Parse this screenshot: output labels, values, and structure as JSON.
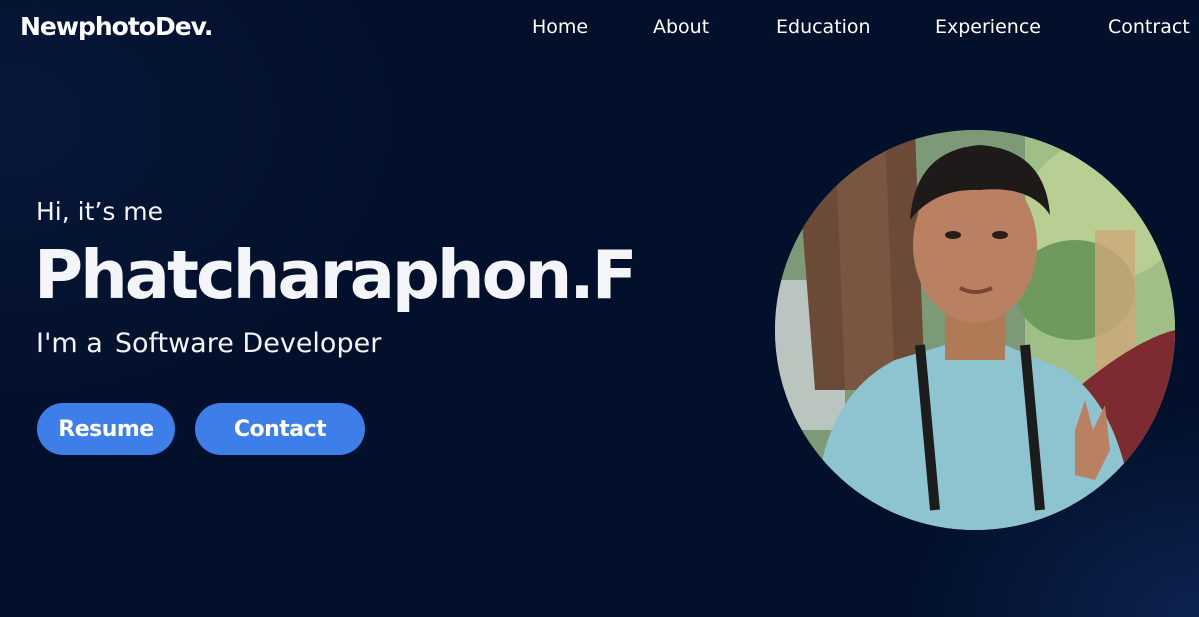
{
  "navbar": {
    "logo": "NewphotoDev.",
    "items": [
      {
        "label": "Home"
      },
      {
        "label": "About"
      },
      {
        "label": "Education"
      },
      {
        "label": "Experience"
      },
      {
        "label": "Contract"
      }
    ]
  },
  "hero": {
    "greeting": "Hi, it’s me",
    "name": "Phatcharaphon.F",
    "role_prefix": "I'm a",
    "role": "Software Developer",
    "buttons": {
      "resume": "Resume",
      "contact": "Contact"
    }
  },
  "colors": {
    "background": "#02102b",
    "accent": "#3d7ee8",
    "text": "#ffffff"
  }
}
